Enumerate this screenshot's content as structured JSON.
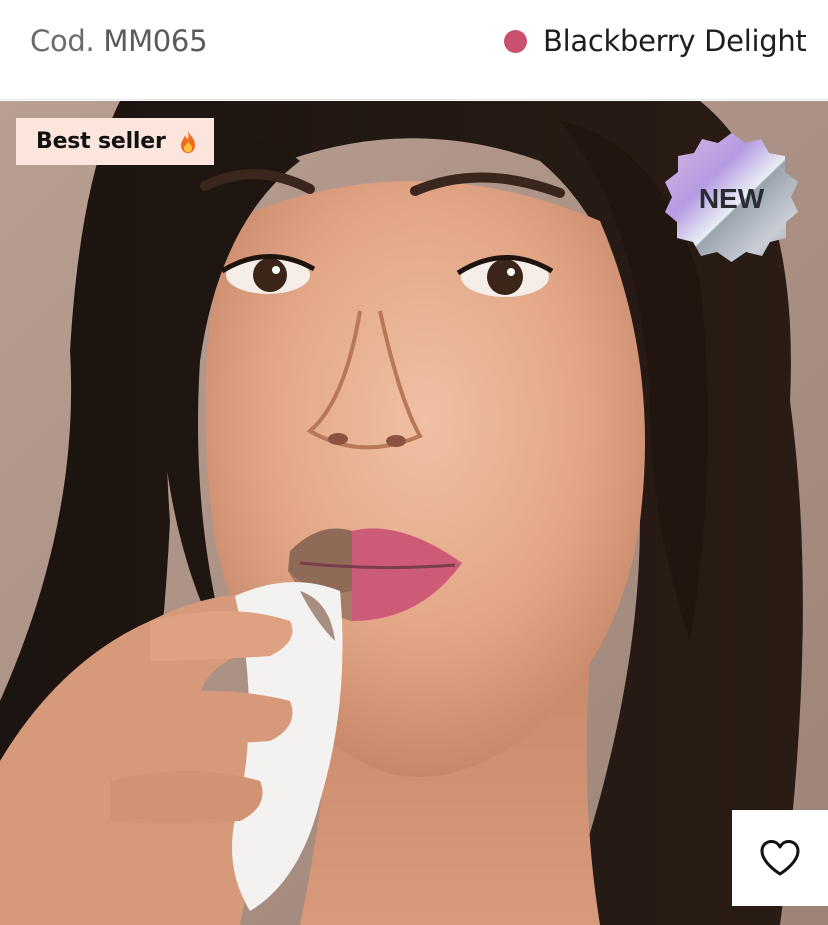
{
  "product": {
    "code_prefix": "Cod.",
    "code_value": "MM065",
    "color_name": "Blackberry Delight",
    "color_hex": "#c9516f"
  },
  "badges": {
    "best_seller_label": "Best seller",
    "best_seller_icon": "fire-icon",
    "new_label": "NEW"
  },
  "actions": {
    "wishlist_icon": "heart-icon"
  },
  "image": {
    "subject": "product-model-photo"
  }
}
